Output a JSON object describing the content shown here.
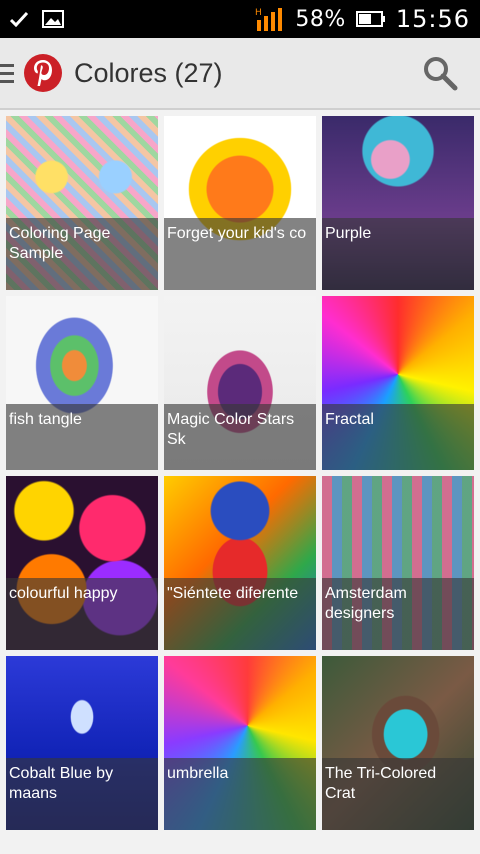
{
  "status_bar": {
    "battery_percent": "58%",
    "time": "15:56",
    "icons": [
      "check-icon",
      "image-icon",
      "signal-icon",
      "battery-icon"
    ]
  },
  "app_bar": {
    "title": "Colores (27)",
    "icons": [
      "menu-icon",
      "pinterest-logo-icon",
      "search-icon"
    ],
    "brand_color": "#cb2027"
  },
  "boards": [
    {
      "label": "Coloring Page Sample"
    },
    {
      "label": "Forget your kid's co"
    },
    {
      "label": "Purple"
    },
    {
      "label": "fish tangle"
    },
    {
      "label": "Magic Color Stars Sk"
    },
    {
      "label": "Fractal"
    },
    {
      "label": "colourful happy"
    },
    {
      "label": "\"Siéntete diferente"
    },
    {
      "label": "Amsterdam designers"
    },
    {
      "label": "Cobalt Blue by maans"
    },
    {
      "label": "umbrella"
    },
    {
      "label": "The Tri-Colored Crat"
    }
  ]
}
